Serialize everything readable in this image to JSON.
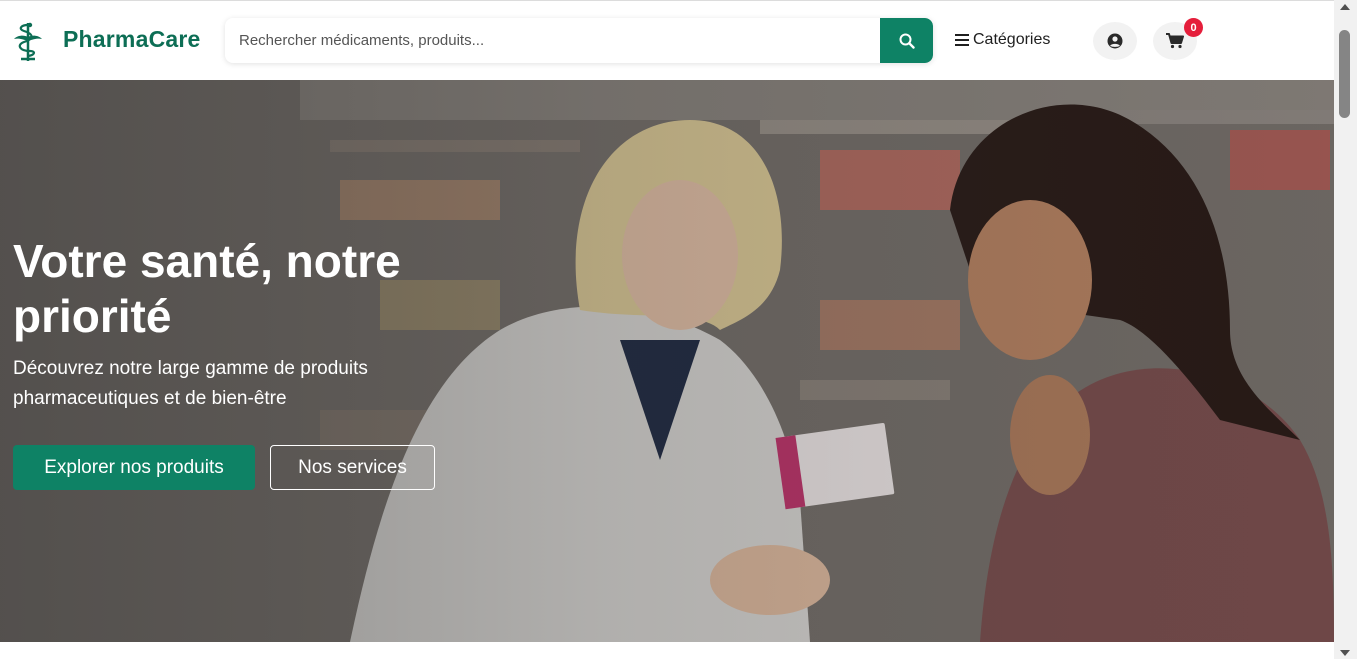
{
  "header": {
    "brand": "PharmaCare",
    "search_placeholder": "Rechercher médicaments, produits...",
    "categories_label": "Catégories",
    "cart_count": "0"
  },
  "hero": {
    "title": "Votre santé, notre priorité",
    "subtitle": "Découvrez notre large gamme de produits pharmaceutiques et de bien-être",
    "primary_button": "Explorer nos produits",
    "secondary_button": "Nos services"
  },
  "icons": {
    "logo": "pharmacy-caduceus-icon",
    "search": "search-icon",
    "menu": "bars-icon",
    "user": "user-circle-icon",
    "cart": "cart-icon"
  },
  "colors": {
    "brand": "#0d6e55",
    "primary": "#0e8265",
    "badge": "#e51e3b"
  }
}
